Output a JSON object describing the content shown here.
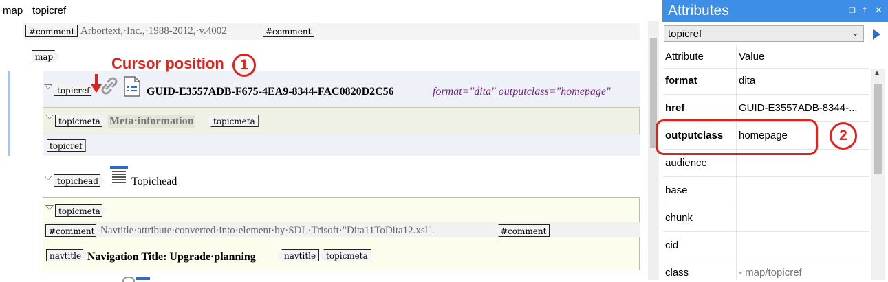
{
  "breadcrumb": [
    "map",
    "topicref"
  ],
  "editor": {
    "comment1": {
      "open_tag": "#comment",
      "text": "Arbortext,·Inc.,·1988-2012,·v.4002",
      "close_tag": "#comment"
    },
    "map_tag": "map",
    "topicref": {
      "open_tag": "topicref",
      "guid": "GUID-E3557ADB-F675-4EA9-8344-FAC0820D2C56",
      "attrs_text": "format=\"dita\" outputclass=\"homepage\"",
      "close_tag": "topicref"
    },
    "topicmeta1": {
      "open_tag": "topicmeta",
      "text": "Meta·information",
      "close_tag": "topicmeta"
    },
    "topichead": {
      "open_tag": "topichead",
      "text": "Topichead"
    },
    "topicmeta2": {
      "open_tag": "topicmeta",
      "comment": {
        "open_tag": "#comment",
        "text": "Navtitle·attribute·converted·into·element·by·SDL·Trisoft·\"Dita11ToDita12.xsl\".",
        "close_tag": "#comment"
      },
      "navtitle": {
        "open_tag": "navtitle",
        "text": "Navigation Title: Upgrade·planning",
        "close_tag": "navtitle"
      },
      "close_tag": "topicmeta"
    }
  },
  "annotations": {
    "cursor_label": "Cursor position",
    "callout1": "1",
    "callout2": "2"
  },
  "attributes_panel": {
    "title": "Attributes",
    "element_select": "topicref",
    "columns": {
      "attribute": "Attribute",
      "value": "Value"
    },
    "rows": [
      {
        "name": "format",
        "value": "dita",
        "bold": true
      },
      {
        "name": "href",
        "value": "GUID-E3557ADB-8344-...",
        "bold": true
      },
      {
        "name": "outputclass",
        "value": "homepage",
        "bold": true
      },
      {
        "name": "audience",
        "value": "",
        "bold": false
      },
      {
        "name": "base",
        "value": "",
        "bold": false
      },
      {
        "name": "chunk",
        "value": "",
        "bold": false
      },
      {
        "name": "cid",
        "value": "",
        "bold": false
      },
      {
        "name": "class",
        "value": "- map/topicref",
        "bold": false
      }
    ]
  },
  "colors": {
    "accent": "#3d8ee6",
    "annotation_red": "#e3211c",
    "attr_purple": "#7a1f8c"
  },
  "icons": [
    "link-icon",
    "document-icon",
    "topichead-icon",
    "pin-icon",
    "close-icon",
    "restore-icon",
    "chevron-down-icon",
    "go-arrow-icon"
  ]
}
